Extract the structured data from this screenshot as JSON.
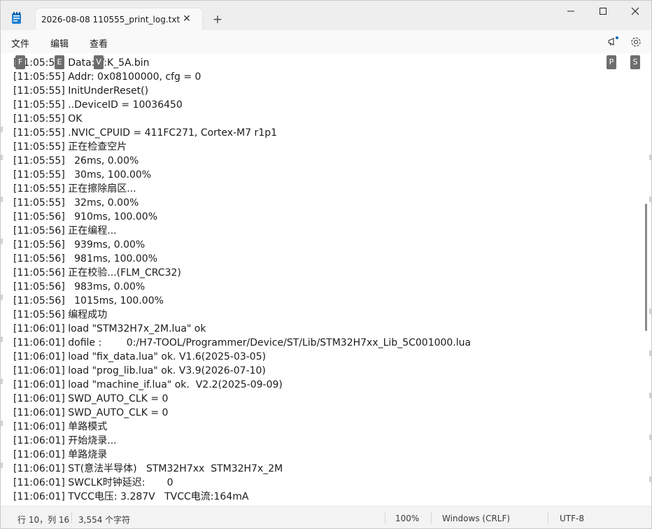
{
  "window": {
    "tab_title": "2026-08-08 110555_print_log.txt",
    "tab_close": "✕",
    "new_tab": "+",
    "minimize": "minimize-icon",
    "maximize": "maximize-icon",
    "close": "close-icon"
  },
  "menu": {
    "file": "文件",
    "edit": "编辑",
    "view": "查看"
  },
  "keytips": {
    "file": "F",
    "edit": "E",
    "view": "V",
    "copilot": "P",
    "settings": "S"
  },
  "editor": {
    "lines": [
      "[11:05:55] Data: V:K_5A.bin",
      "[11:05:55] Addr: 0x08100000, cfg = 0",
      "[11:05:55] InitUnderReset()",
      "[11:05:55] ..DeviceID = 10036450",
      "[11:05:55] OK",
      "[11:05:55] .NVIC_CPUID = 411FC271, Cortex-M7 r1p1",
      "[11:05:55] 正在检查空片",
      "[11:05:55]   26ms, 0.00%",
      "[11:05:55]   30ms, 100.00%",
      "[11:05:55] 正在擦除扇区...",
      "[11:05:55]   32ms, 0.00%",
      "[11:05:56]   910ms, 100.00%",
      "[11:05:56] 正在编程...",
      "[11:05:56]   939ms, 0.00%",
      "[11:05:56]   981ms, 100.00%",
      "[11:05:56] 正在校验...(FLM_CRC32)",
      "[11:05:56]   983ms, 0.00%",
      "[11:05:56]   1015ms, 100.00%",
      "[11:05:56] 编程成功",
      "[11:06:01] load \"STM32H7x_2M.lua\" ok",
      "[11:06:01] dofile :        0:/H7-TOOL/Programmer/Device/ST/Lib/STM32H7xx_Lib_5C001000.lua",
      "[11:06:01] load \"fix_data.lua\" ok. V1.6(2025-03-05)",
      "[11:06:01] load \"prog_lib.lua\" ok. V3.9(2026-07-10)",
      "[11:06:01] load \"machine_if.lua\" ok.  V2.2(2025-09-09)",
      "[11:06:01] SWD_AUTO_CLK = 0",
      "[11:06:01] SWD_AUTO_CLK = 0",
      "[11:06:01] 单路模式",
      "[11:06:01] 开始烧录...",
      "[11:06:01] 单路烧录",
      "[11:06:01] ST(意法半导体)   STM32H7xx  STM32H7x_2M",
      "[11:06:01] SWCLK时钟延迟:       0",
      "[11:06:01] TVCC电压: 3.287V   TVCC电流:164mA"
    ]
  },
  "status": {
    "position": "行 10，列 16",
    "chars": "3,554 个字符",
    "zoom": "100%",
    "line_ending": "Windows (CRLF)",
    "encoding": "UTF-8"
  },
  "colors": {
    "accent": "#0067c0",
    "keytip_bg": "#6e6e6e"
  }
}
